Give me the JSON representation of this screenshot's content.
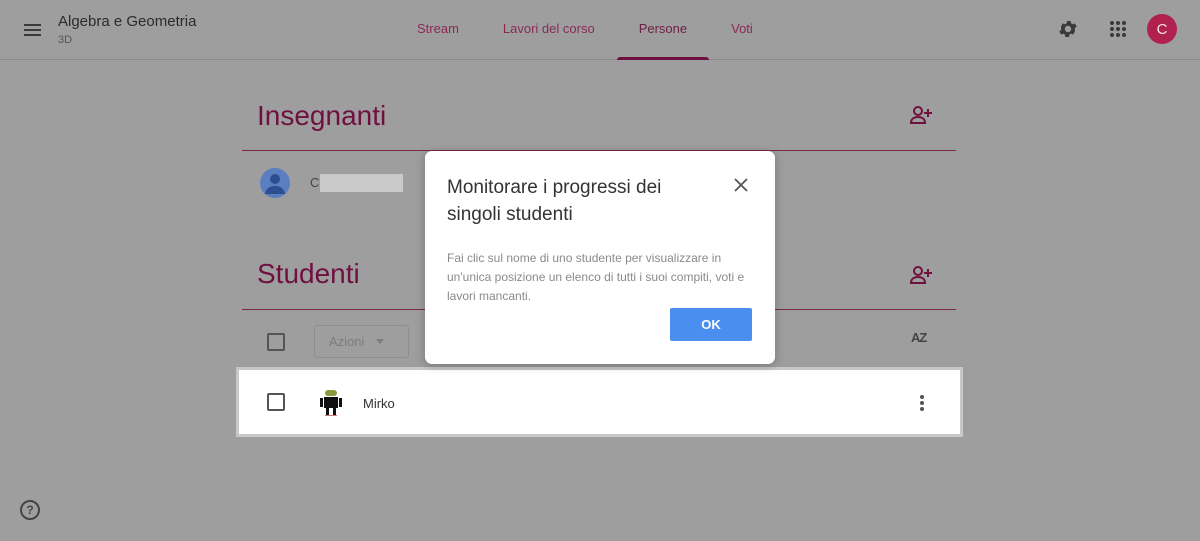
{
  "header": {
    "class_title": "Algebra e Geometria",
    "class_section": "3D",
    "tabs": [
      {
        "label": "Stream",
        "active": false
      },
      {
        "label": "Lavori del corso",
        "active": false
      },
      {
        "label": "Persone",
        "active": true
      },
      {
        "label": "Voti",
        "active": false
      }
    ],
    "icons": [
      "menu-icon",
      "settings-gear-icon",
      "apps-grid-icon"
    ],
    "account_initial": "C",
    "accent_color": "#6e1040"
  },
  "teachers": {
    "title": "Insegnanti",
    "list": [
      {
        "initial_visible": "C",
        "name_redacted": true
      }
    ]
  },
  "students": {
    "title": "Studenti",
    "actions_label": "Azioni",
    "sort_label": "AZ",
    "list": [
      {
        "name": "Mirko"
      }
    ]
  },
  "dialog": {
    "title": "Monitorare i progressi dei singoli studenti",
    "body": "Fai clic sul nome di uno studente per visualizzare in un'unica posizione un elenco di tutti i suoi compiti, voti e lavori mancanti.",
    "ok_label": "OK",
    "ok_color": "#4a8ef0"
  },
  "help": {
    "label": "?"
  }
}
